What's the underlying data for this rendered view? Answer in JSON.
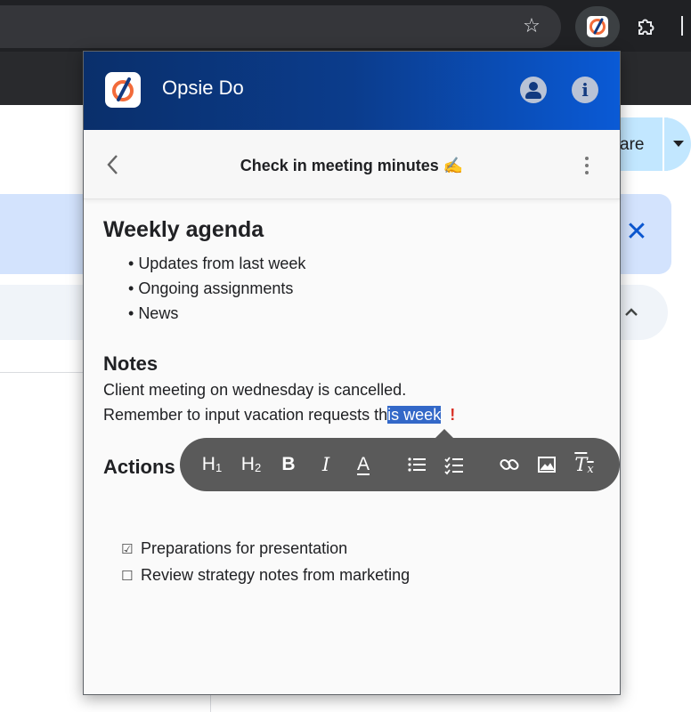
{
  "browser": {
    "star_icon": "star-icon",
    "extensions": [
      "opsie-do-extension-icon",
      "puzzle-icon"
    ]
  },
  "page": {
    "share_label": "are",
    "banner_close_icon": "close-icon"
  },
  "popup": {
    "app_title": "Opsie Do",
    "header_icons": [
      "user-icon",
      "info-icon"
    ],
    "info_glyph": "i",
    "note": {
      "title": "Check in meeting minutes",
      "title_emoji": "✍️"
    },
    "content": {
      "heading1": "Weekly agenda",
      "agenda_items": [
        "Updates from last week",
        "Ongoing assignments",
        "News"
      ],
      "notes_heading": "Notes",
      "notes_line1": "Client meeting on wednesday is cancelled.",
      "notes_line2_before": "Remember to input vacation requests th",
      "notes_line2_selected": "is week",
      "notes_line2_mark": "!",
      "actions_heading": "Actions",
      "actions": [
        {
          "checked": true,
          "label": "Preparations for presentation"
        },
        {
          "checked": false,
          "label": "Review strategy notes from marketing"
        }
      ]
    },
    "toolbar": {
      "h1": "H",
      "h1_sub": "1",
      "h2": "H",
      "h2_sub": "2",
      "bold": "B",
      "italic": "I",
      "color": "A",
      "clear_format": "T",
      "clear_format_sub": "x"
    }
  },
  "colors": {
    "header_start": "#0a2f6b",
    "header_end": "#0a5ad6",
    "selection": "#3368c8",
    "toolbar": "#5a5a5a",
    "accent_orange": "#f26b3a"
  }
}
